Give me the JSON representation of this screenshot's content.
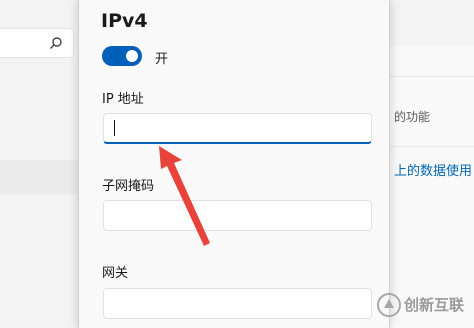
{
  "background": {
    "right_text": "的功能",
    "right_link": "上的数据使用"
  },
  "dialog": {
    "title": "IPv4",
    "toggle": {
      "state": "on",
      "label": "开"
    },
    "fields": [
      {
        "label": "IP 地址",
        "value": "",
        "focused": true
      },
      {
        "label": "子网掩码",
        "value": "",
        "focused": false
      },
      {
        "label": "网关",
        "value": "",
        "focused": false
      }
    ]
  },
  "annotation": {
    "type": "arrow",
    "color": "#e8433a",
    "points_to": "IP 地址 input"
  },
  "watermark": {
    "text": "创新互联"
  },
  "colors": {
    "accent": "#005fb8",
    "link": "#0066b4"
  },
  "icons": [
    "search-icon",
    "arrow-icon",
    "watermark-logo"
  ]
}
